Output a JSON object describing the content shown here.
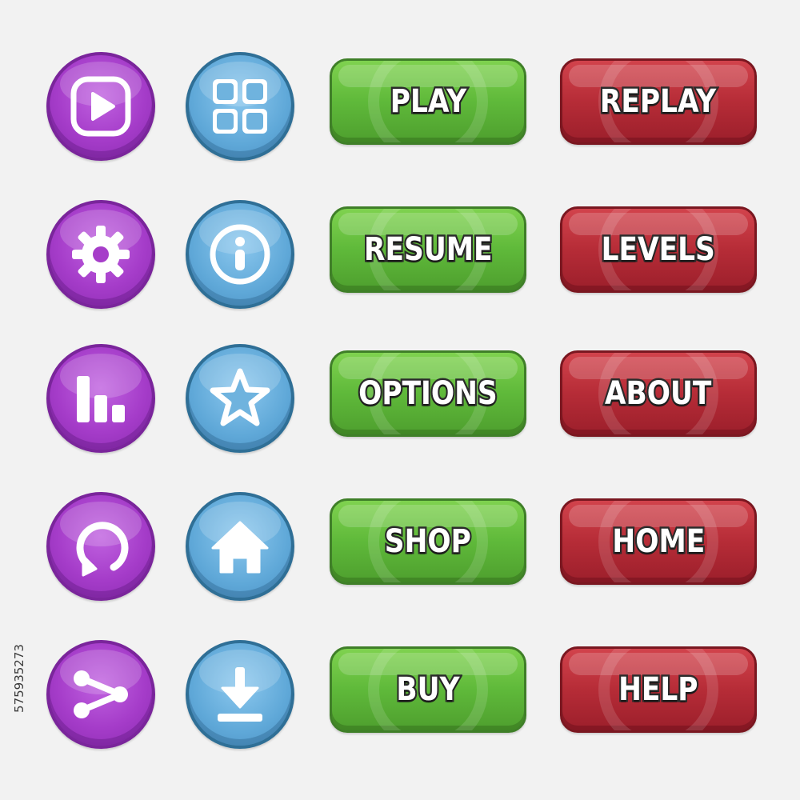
{
  "rows": [
    {
      "purple_icon": "play-icon",
      "blue_icon": "grid-menu-icon",
      "green_label": "PLAY",
      "red_label": "REPLAY"
    },
    {
      "purple_icon": "gear-icon",
      "blue_icon": "info-icon",
      "green_label": "RESUME",
      "red_label": "LEVELS"
    },
    {
      "purple_icon": "leaderboard-icon",
      "blue_icon": "star-icon",
      "green_label": "OPTIONS",
      "red_label": "ABOUT"
    },
    {
      "purple_icon": "restart-icon",
      "blue_icon": "home-icon",
      "green_label": "SHOP",
      "red_label": "HOME"
    },
    {
      "purple_icon": "share-icon",
      "blue_icon": "download-icon",
      "green_label": "BUY",
      "red_label": "HELP"
    }
  ],
  "watermark": "575935273",
  "colors": {
    "background": "#f2f2f2",
    "purple": "#a53cc9",
    "blue": "#5fa8d8",
    "green": "#5fb93a",
    "red": "#b62c37"
  }
}
